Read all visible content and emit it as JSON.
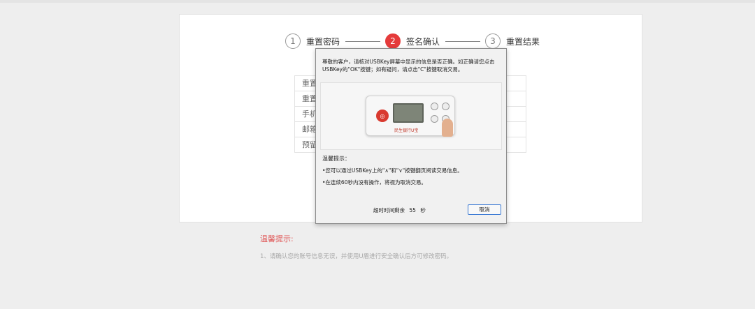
{
  "steps": [
    {
      "number": "1",
      "label": "重置密码"
    },
    {
      "number": "2",
      "label": "签名确认"
    },
    {
      "number": "3",
      "label": "重置结果"
    }
  ],
  "form_rows": [
    "重置",
    "重置",
    "手机",
    "邮箱",
    "预留"
  ],
  "dialog": {
    "message": "尊敬的客户，请核对USBKey屏幕中显示的信息是否正确。如正确请您点击USBKey的\"OK\"按键；如有疑问，请点击\"C\"按键取消交易。",
    "device_brand": "民生银行U宝",
    "tips_title": "温馨提示：",
    "tips": [
      "•您可以通过USBKey上的\"∧\"和\"∨\"按键翻页阅读交易信息。",
      "•在连续60秒内没有操作，将视为取消交易。"
    ],
    "countdown_prefix": "超时时间剩余",
    "countdown_value": "55",
    "countdown_unit": "秒",
    "cancel_label": "取消"
  },
  "warm_tips": {
    "title": "温馨提示:",
    "items": [
      "1、请确认您的账号信息无误，并使用U盾进行安全确认后方可修改密码。"
    ]
  },
  "colors": {
    "active_step": "#e53b3b",
    "warm_title": "#e05a5a",
    "cancel_border": "#3d7bd4"
  }
}
